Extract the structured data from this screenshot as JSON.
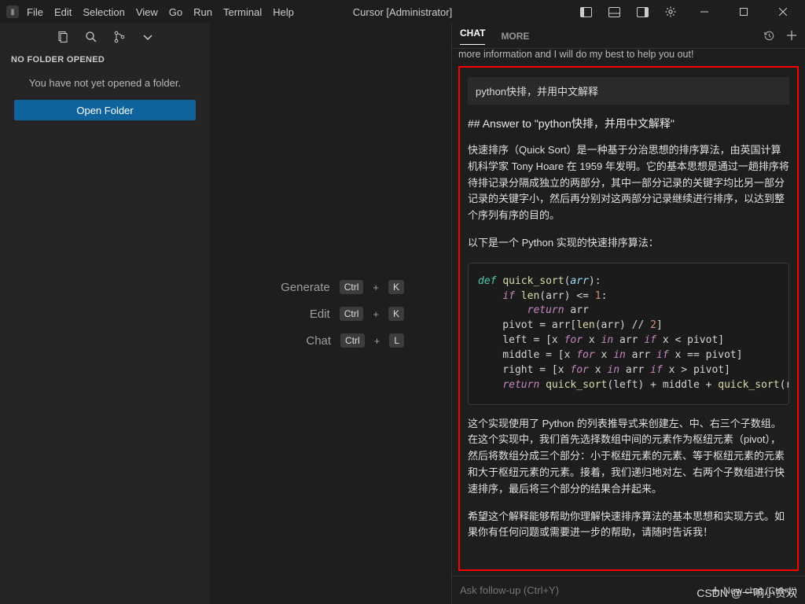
{
  "titlebar": {
    "title": "Cursor [Administrator]",
    "menu": [
      "File",
      "Edit",
      "Selection",
      "View",
      "Go",
      "Run",
      "Terminal",
      "Help"
    ]
  },
  "sidebar": {
    "title": "NO FOLDER OPENED",
    "message": "You have not yet opened a folder.",
    "open_button_label": "Open Folder"
  },
  "editor_shortcuts": [
    {
      "label": "Generate",
      "keys": [
        "Ctrl",
        "K"
      ]
    },
    {
      "label": "Edit",
      "keys": [
        "Ctrl",
        "K"
      ]
    },
    {
      "label": "Chat",
      "keys": [
        "Ctrl",
        "L"
      ]
    }
  ],
  "chat": {
    "tabs": {
      "chat": "CHAT",
      "more": "MORE"
    },
    "truncated_line": "more information and I will do my best to help you out!",
    "user_prompt": "python快排，并用中文解释",
    "answer_heading": "## Answer to \"python快排，并用中文解释\"",
    "para1": "快速排序（Quick Sort）是一种基于分治思想的排序算法，由英国计算机科学家 Tony Hoare 在 1959 年发明。它的基本思想是通过一趟排序将待排记录分隔成独立的两部分，其中一部分记录的关键字均比另一部分记录的关键字小，然后再分别对这两部分记录继续进行排序，以达到整个序列有序的目的。",
    "para2": "以下是一个 Python 实现的快速排序算法：",
    "para3": "这个实现使用了 Python 的列表推导式来创建左、中、右三个子数组。在这个实现中，我们首先选择数组中间的元素作为枢纽元素（pivot），然后将数组分成三个部分：小于枢纽元素的元素、等于枢纽元素的元素和大于枢纽元素的元素。接着，我们递归地对左、右两个子数组进行快速排序，最后将三个部分的结果合并起来。",
    "para4": "希望这个解释能够帮助你理解快速排序算法的基本思想和实现方式。如果你有任何问题或需要进一步的帮助，请随时告诉我！",
    "code_lines": [
      "def quick_sort(arr):",
      "    if len(arr) <= 1:",
      "        return arr",
      "    pivot = arr[len(arr) // 2]",
      "    left = [x for x in arr if x < pivot]",
      "    middle = [x for x in arr if x == pivot]",
      "    right = [x for x in arr if x > pivot]",
      "    return quick_sort(left) + middle + quick_sort(ri"
    ],
    "followup_placeholder": "Ask follow-up (Ctrl+Y)",
    "newchat_label": "New chat (Ctrl+L)"
  },
  "watermark": "CSDN @一响小贪欢"
}
